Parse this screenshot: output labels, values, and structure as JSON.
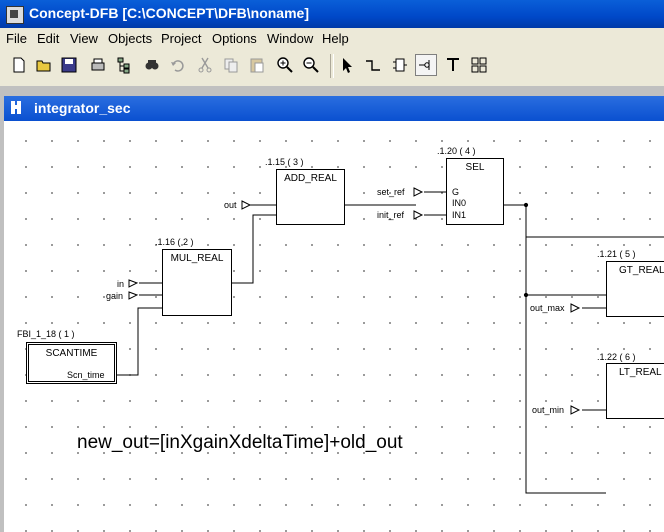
{
  "window": {
    "title": "Concept-DFB [C:\\CONCEPT\\DFB\\noname]"
  },
  "menu": [
    "File",
    "Edit",
    "View",
    "Objects",
    "Project",
    "Options",
    "Window",
    "Help"
  ],
  "toolbar": {
    "icons": [
      "new-icon",
      "open-icon",
      "save-icon",
      "print-icon",
      "tree-icon",
      "find-icon",
      "undo-icon",
      "cut-icon",
      "copy-icon",
      "paste-icon",
      "zoom-in-icon",
      "zoom-out-icon",
      "select-arrow-icon",
      "link-icon",
      "fb-icon",
      "pin-icon",
      "text-icon",
      "grid-icon"
    ]
  },
  "document": {
    "title": "integrator_sec"
  },
  "blocks": {
    "add": {
      "id": ".1.15 ( 3 )",
      "name": "ADD_REAL"
    },
    "sel": {
      "id": ".1.20 ( 4 )",
      "name": "SEL",
      "pins": [
        "G",
        "IN0",
        "IN1"
      ]
    },
    "mul": {
      "id": ".1.16 ( 2 )",
      "name": "MUL_REAL"
    },
    "scan": {
      "id": "FBI_1_18 ( 1 )",
      "name": "SCANTIME",
      "pin": "Scn_time"
    },
    "gt": {
      "id": ".1.21 ( 5 )",
      "name": "GT_REAL"
    },
    "lt": {
      "id": ".1.22 ( 6 )",
      "name": "LT_REAL"
    }
  },
  "variables": {
    "out": "out",
    "set_ref": "set_ref",
    "init_ref": "init_ref",
    "in": "in",
    "gain": "gain",
    "out_max": "out_max",
    "out_min": "out_min"
  },
  "annotation": "new_out=[inXgainXdeltaTime]+old_out"
}
